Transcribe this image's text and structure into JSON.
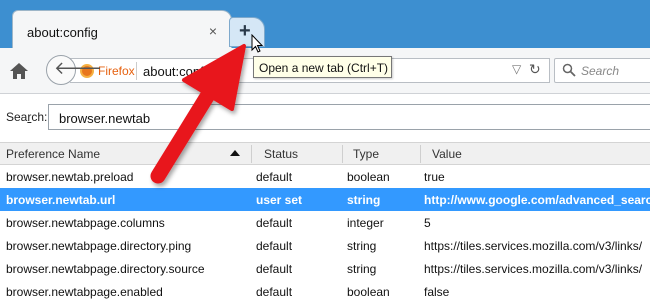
{
  "tabs": [
    {
      "title": "about:config",
      "close_glyph": "×"
    }
  ],
  "newtab_glyph": "+",
  "tooltip": "Open a new tab (Ctrl+T)",
  "navbar": {
    "identity_label": "Firefox",
    "url": "about:config",
    "search_placeholder": "Search"
  },
  "filter": {
    "label_accesskey": "r",
    "label_rest": "Sea",
    "label_tail": "ch:",
    "value": "browser.newtab"
  },
  "table": {
    "columns": [
      "Preference Name",
      "Status",
      "Type",
      "Value"
    ],
    "rows": [
      {
        "name": "browser.newtab.preload",
        "status": "default",
        "type": "boolean",
        "value": "true",
        "selected": false
      },
      {
        "name": "browser.newtab.url",
        "status": "user set",
        "type": "string",
        "value": "http://www.google.com/advanced_search",
        "selected": true
      },
      {
        "name": "browser.newtabpage.columns",
        "status": "default",
        "type": "integer",
        "value": "5",
        "selected": false
      },
      {
        "name": "browser.newtabpage.directory.ping",
        "status": "default",
        "type": "string",
        "value": "https://tiles.services.mozilla.com/v3/links/",
        "selected": false
      },
      {
        "name": "browser.newtabpage.directory.source",
        "status": "default",
        "type": "string",
        "value": "https://tiles.services.mozilla.com/v3/links/",
        "selected": false
      },
      {
        "name": "browser.newtabpage.enabled",
        "status": "default",
        "type": "boolean",
        "value": "false",
        "selected": false
      }
    ]
  },
  "colors": {
    "tabstrip": "#3d8fd0",
    "selection": "#3399ff",
    "annotation_arrow": "#e8131b",
    "firefox_orange": "#e6610f"
  }
}
